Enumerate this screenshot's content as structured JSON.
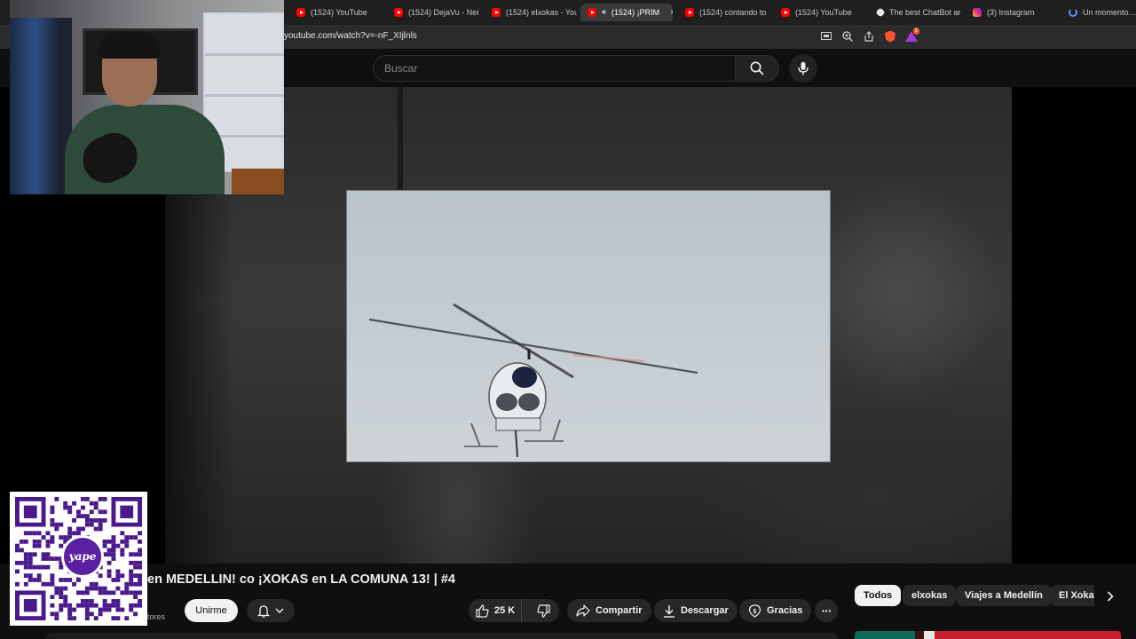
{
  "browser": {
    "tabs": [
      {
        "label": "(1524) YouTube",
        "icon": "youtube-icon",
        "active": false
      },
      {
        "label": "(1524) DejaVu - Nei",
        "icon": "youtube-icon",
        "active": false
      },
      {
        "label": "(1524) elxokas - You",
        "icon": "youtube-icon",
        "active": false
      },
      {
        "label": "(1524) ¡PRIM",
        "icon": "youtube-icon",
        "active": true,
        "close": "×"
      },
      {
        "label": "(1524) contando to",
        "icon": "youtube-icon",
        "active": false
      },
      {
        "label": "(1524) YouTube",
        "icon": "youtube-icon",
        "active": false
      },
      {
        "label": "The best ChatBot ar",
        "icon": "chatbot-icon",
        "active": false
      },
      {
        "label": "(3) Instagram",
        "icon": "instagram-icon",
        "active": false
      },
      {
        "label": "Un momento…",
        "icon": "loading-icon",
        "active": false
      }
    ],
    "url": "youtube.com/watch?v=-nF_XIjlnls",
    "rewards_badge": "1",
    "colors": {
      "tabbar": "#1f1f1f",
      "addrbar": "#2b2b2b",
      "brave": "#fb542b"
    }
  },
  "youtube": {
    "search": {
      "placeholder": "Buscar"
    },
    "video": {
      "title": "en MEDELLIN! co ¡XOKAS en LA COMUNA 13! | #4",
      "subs_fragment": "tores"
    },
    "actions": {
      "join_label": "Unirme",
      "likes": "25 K",
      "share_label": "Compartir",
      "download_label": "Descargar",
      "thanks_label": "Gracias",
      "more": "···"
    },
    "chips": [
      "Todos",
      "elxokas",
      "Viajes a Medellín",
      "El Xoka"
    ],
    "chips_selected": "Todos"
  },
  "overlays": {
    "qr_badge_text": "yape"
  },
  "colors": {
    "background": "#0f0f0f",
    "accent_red": "#ff0000",
    "yape_purple": "#5b1fa1"
  }
}
